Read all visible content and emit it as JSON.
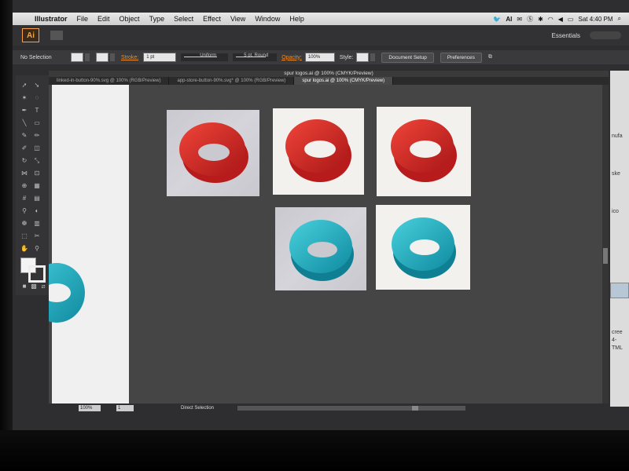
{
  "menubar": {
    "app_name": "Illustrator",
    "items": [
      "File",
      "Edit",
      "Object",
      "Type",
      "Select",
      "Effect",
      "View",
      "Window",
      "Help"
    ],
    "clock": "Sat 4:40 PM",
    "status_ai": "AI"
  },
  "appbar": {
    "logo": "Ai",
    "workspace": "Essentials"
  },
  "controlbar": {
    "selection": "No Selection",
    "stroke_label": "Stroke:",
    "stroke_weight": "1 pt",
    "stroke_profile": "Uniform",
    "brush": "5 pt. Round",
    "opacity_label": "Opacity:",
    "opacity_value": "100%",
    "style_label": "Style:",
    "document_setup": "Document Setup",
    "preferences": "Preferences"
  },
  "document": {
    "title": "spur logos.ai @ 100% (CMYK/Preview)",
    "tabs": [
      {
        "label": "linked-in-button-90%.svg @ 100% (RGB/Preview)",
        "active": false
      },
      {
        "label": "app-store-button-90%.svg* @ 100% (RGB/Preview)",
        "active": false
      },
      {
        "label": "spur logos.ai @ 100% (CMYK/Preview)",
        "active": true
      }
    ]
  },
  "statusbar": {
    "zoom": "100%",
    "page": "1",
    "tool": "Direct Selection"
  },
  "colors": {
    "red_logo": "#d92525",
    "teal_logo": "#1aa9bf",
    "accent_orange": "#f18c1e"
  },
  "finder": {
    "labels": [
      "nufa",
      "ske",
      "ico",
      "cree",
      "4-",
      "TML"
    ]
  }
}
